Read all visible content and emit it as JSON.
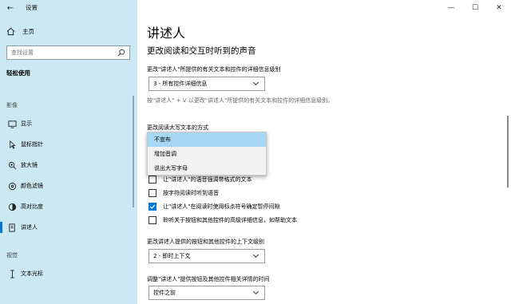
{
  "window": {
    "title": "设置",
    "controls": {
      "minimize": "—",
      "maximize": "☐",
      "close": "✕"
    }
  },
  "sidebar": {
    "home_label": "主页",
    "search_placeholder": "查找设置",
    "section_title": "轻松使用",
    "groups": [
      {
        "title": "影像",
        "items": [
          "显示",
          "鼠标指针",
          "放大镜",
          "颜色滤镜",
          "高对比度",
          "讲述人"
        ]
      },
      {
        "title": "视觉",
        "items": [
          "文本光标"
        ]
      }
    ],
    "active_item": "讲述人"
  },
  "main": {
    "page_title": "讲述人",
    "subtitle": "更改阅读和交互时听到的声音",
    "detail_level": {
      "label": "更改\"讲述人\"所提供的有关文本和控件的详细信息级别",
      "value": "3 - 所有控件详细信息",
      "hint": "按\"讲述人\" + V 以更改\"讲述人\"所提供的有关文本和控件的详细信息级别。"
    },
    "caps_label": "更改阅读大写文本的方式",
    "caps_options": [
      "不宣布",
      "增加音调",
      "说出大写字母"
    ],
    "caps_selected": "不宣布",
    "checkboxes": [
      {
        "label": "让\"讲述人\"的语音强调带格式的文本",
        "checked": false
      },
      {
        "label": "按字符阅读时听到语音",
        "checked": false
      },
      {
        "label": "让\"讲述人\"在阅读时使用标点符号确定暂停间隙",
        "checked": true
      },
      {
        "label": "聆听关于按钮和其他控件的高级详细信息，如帮助文本",
        "checked": false
      }
    ],
    "context_level": {
      "label": "更改讲述人提供的按钮和其他控件的上下文级别",
      "value": "2 - 即时上下文"
    },
    "timing": {
      "label": "调整\"讲述人\"提供按钮及其他控件相关详情的时间",
      "value": "控件之前"
    }
  },
  "icons": {
    "back": "←",
    "chevron": "⌵",
    "check": "✓"
  },
  "colors": {
    "sidebar_bg": "#cce8f2",
    "accent": "#0078d4",
    "dropdown_highlight": "#a6d8f4"
  }
}
